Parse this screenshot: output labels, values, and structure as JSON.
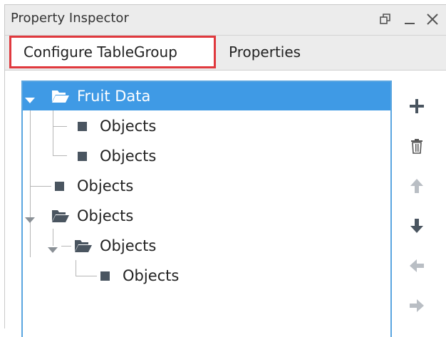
{
  "window": {
    "title": "Property Inspector"
  },
  "tabs": [
    {
      "label": "Configure TableGroup"
    },
    {
      "label": "Properties"
    }
  ],
  "tree": {
    "nodes": [
      {
        "label": "Fruit Data",
        "type": "folder-open",
        "selected": true
      },
      {
        "label": "Objects",
        "type": "object"
      },
      {
        "label": "Objects",
        "type": "object"
      },
      {
        "label": "Objects",
        "type": "object"
      },
      {
        "label": "Objects",
        "type": "folder-open"
      },
      {
        "label": "Objects",
        "type": "folder-open"
      },
      {
        "label": "Objects",
        "type": "object"
      }
    ]
  },
  "toolbar": {
    "icons": [
      "add-icon",
      "delete-icon",
      "move-up-icon",
      "move-down-icon",
      "move-left-icon",
      "move-right-icon"
    ],
    "enabled": [
      true,
      true,
      false,
      true,
      false,
      false
    ]
  },
  "colors": {
    "accent": "#3f9ae5",
    "tab_highlight": "#e0393e",
    "icon_dark": "#4a5560",
    "icon_disabled": "#b9bec4"
  }
}
